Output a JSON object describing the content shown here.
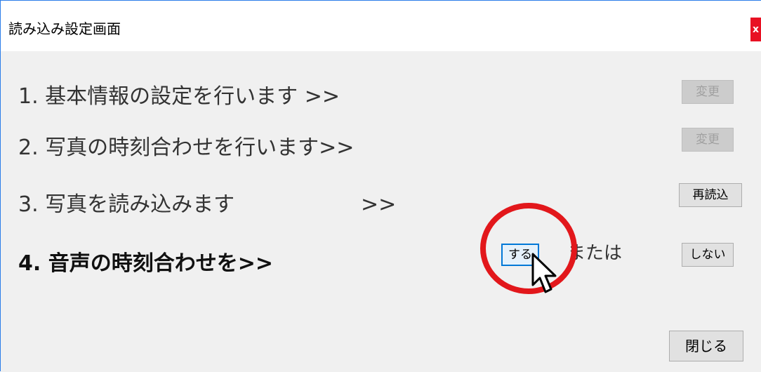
{
  "window": {
    "title": "読み込み設定画面",
    "close_label": "x"
  },
  "steps": [
    {
      "label": "1. 基本情報の設定を行います  >>",
      "button": "変更",
      "button_enabled": false
    },
    {
      "label": "2. 写真の時刻合わせを行います>>",
      "button": "変更",
      "button_enabled": false
    },
    {
      "label": "3. 写真を読み込みます",
      "arrow": ">>",
      "button": "再読込",
      "button_enabled": true
    },
    {
      "label": "4. 音声の時刻合わせを>>",
      "yes_button": "する",
      "or_text": "または",
      "no_button": "しない"
    }
  ],
  "footer": {
    "close_button": "閉じる"
  },
  "annotation": {
    "highlight_color": "#e2171b"
  },
  "colors": {
    "accent": "#0078d7",
    "window_border": "#2b7de9",
    "close": "#e81123",
    "background": "#f0f0f0"
  }
}
